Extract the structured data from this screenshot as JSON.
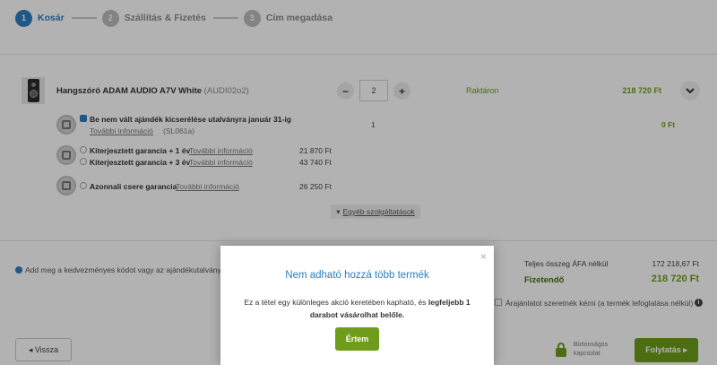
{
  "stepper": {
    "steps": [
      {
        "num": "1",
        "label": "Kosár"
      },
      {
        "num": "2",
        "label": "Szállítás & Fizetés"
      },
      {
        "num": "3",
        "label": "Cím megadása"
      }
    ]
  },
  "product": {
    "name": "Hangszóró ADAM AUDIO A7V White",
    "code": "(AUDI02o2)",
    "qty_minus": "−",
    "qty": "2",
    "qty_plus": "+",
    "stock": "Raktáron",
    "price": "218 720 Ft"
  },
  "services": [
    {
      "title": "Be nem vált ajándék kicserélése utalványra január 31-ig",
      "link": "További információ",
      "code": "(SL061a)",
      "qty": "1",
      "price": "0 Ft"
    },
    {
      "title": "Kiterjesztett garancia + 1 év",
      "link": "További információ",
      "price": "21 870 Ft"
    },
    {
      "title": "Kiterjesztett garancia + 3 év",
      "link": "További információ",
      "price": "43 740 Ft"
    },
    {
      "title": "Azonnali csere garancia",
      "link": "További információ",
      "price": "26 250 Ft"
    }
  ],
  "other_services": {
    "arrow": "▾",
    "label": "Egyéb szolgáltatások"
  },
  "summary": {
    "coupon_text": "Add meg a kedvezményes kódot vagy az ajándékutalvány",
    "net_label": "Teljes összeg ÁFA nélkül",
    "net_value": "172 218,67 Ft",
    "pay_label": "Fizetendő",
    "pay_value": "218 720 Ft",
    "quote_label": "Árajánlatot szeretnék kérni (a termék lefoglalása nélkül)",
    "info": "i"
  },
  "nav": {
    "back_label": "◂ Vissza",
    "secure_line1": "Biztonságos",
    "secure_line2": "kapcsolat",
    "next_label": "Folytatás ▸"
  },
  "modal": {
    "close": "×",
    "title": "Nem adható hozzá több termék",
    "body_prefix": "Ez a tétel egy különleges akció keretében kapható, és ",
    "body_bold": "legfeljebb 1 darabot vásárolhat belőle.",
    "ok_label": "Értem"
  },
  "colors": {
    "accent_blue": "#2b7fc0",
    "accent_green": "#6f9c1b"
  }
}
